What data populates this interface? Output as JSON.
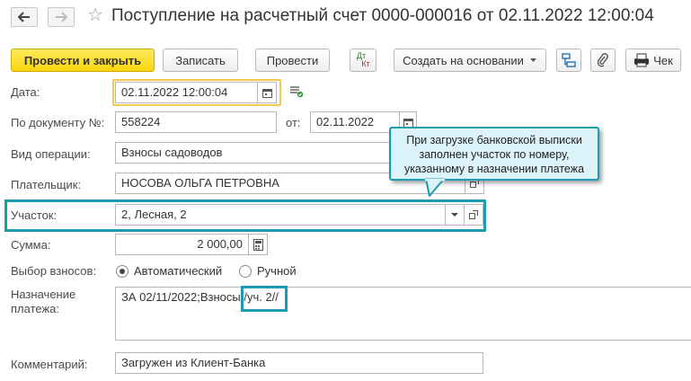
{
  "header": {
    "title": "Поступление на расчетный счет 0000-000016 от 02.11.2022 12:00:04",
    "back_icon": "arrow-left-icon",
    "forward_icon": "arrow-right-icon",
    "favorite_icon": "star-icon"
  },
  "toolbar": {
    "post_close_label": "Провести и закрыть",
    "save_label": "Записать",
    "post_label": "Провести",
    "dt_kt_top": "Дт",
    "dt_kt_bottom": "Кт",
    "create_based_label": "Создать на основании",
    "check_label": "Чек",
    "accent_color": "#f7d50e"
  },
  "form": {
    "date_label": "Дата:",
    "date_value": "02.11.2022 12:00:04",
    "doc_no_label": "По документу №:",
    "doc_no_value": "558224",
    "from_label": "от:",
    "from_value": "02.11.2022",
    "operation_label": "Вид операции:",
    "operation_value": "Взносы садоводов",
    "payer_label": "Плательщик:",
    "payer_value": "НОСОВА ОЛЬГА ПЕТРОВНА",
    "plot_label": "Участок:",
    "plot_value": "2, Лесная, 2",
    "amount_label": "Сумма:",
    "amount_value": "2 000,00",
    "choice_label": "Выбор взносов:",
    "choice_auto": "Автоматический",
    "choice_manual": "Ручной",
    "choice_selected": "Автоматический",
    "purpose_label_1": "Назначение",
    "purpose_label_2": "платежа:",
    "purpose_value": "ЗА 02/11/2022;Взносы//уч. 2//",
    "comment_label": "Комментарий:",
    "comment_value": "Загружен из Клиент-Банка"
  },
  "callout": {
    "line1": "При загрузке банковской выписки",
    "line2": "заполнен участок по номеру,",
    "line3": "указанному в назначении платежа",
    "highlight_color": "#1d9bb0"
  }
}
